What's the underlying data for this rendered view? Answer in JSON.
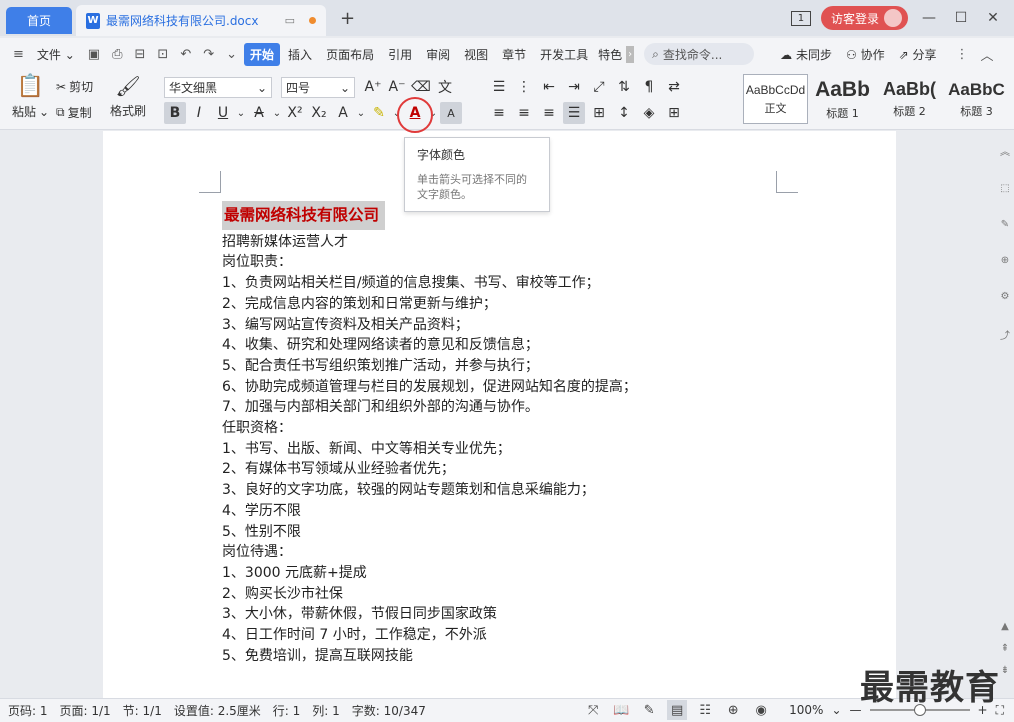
{
  "titlebar": {
    "home_tab": "首页",
    "doc_tab": "最需网络科技有限公司.docx",
    "doc_icon": "W",
    "window_count": "1",
    "login_label": "访客登录",
    "add_tab": "+"
  },
  "menubar": {
    "file": "文件",
    "tabs": [
      "开始",
      "插入",
      "页面布局",
      "引用",
      "审阅",
      "视图",
      "章节",
      "开发工具",
      "特色"
    ],
    "search": "查找命令...",
    "sync": "未同步",
    "collab": "协作",
    "share": "分享"
  },
  "ribbon": {
    "paste": "粘贴",
    "cut": "剪切",
    "copy": "复制",
    "format_painter": "格式刷",
    "font_name": "华文细黑",
    "font_size": "四号",
    "styles": [
      {
        "preview": "AaBbCcDd",
        "label": "正文"
      },
      {
        "preview": "AaBb",
        "label": "标题 1"
      },
      {
        "preview": "AaBb(",
        "label": "标题 2"
      },
      {
        "preview": "AaBbC",
        "label": "标题 3"
      }
    ]
  },
  "tooltip": {
    "title": "字体颜色",
    "body": "单击箭头可选择不同的文字颜色。"
  },
  "document": {
    "heading": "最需网络科技有限公司",
    "lines": [
      "招聘新媒体运营人才",
      "岗位职责：",
      "1、负责网站相关栏目/频道的信息搜集、书写、审校等工作；",
      "2、完成信息内容的策划和日常更新与维护；",
      "3、编写网站宣传资料及相关产品资料；",
      "4、收集、研究和处理网络读者的意见和反馈信息；",
      "5、配合责任书写组织策划推广活动，并参与执行；",
      "6、协助完成频道管理与栏目的发展规划，促进网站知名度的提高；",
      "7、加强与内部相关部门和组织外部的沟通与协作。",
      "任职资格：",
      "1、书写、出版、新闻、中文等相关专业优先；",
      "2、有媒体书写领域从业经验者优先；",
      "3、良好的文字功底，较强的网站专题策划和信息采编能力；",
      "4、学历不限",
      "5、性别不限",
      "岗位待遇：",
      "1、3000 元底薪+提成",
      "2、购买长沙市社保",
      "3、大小休，带薪休假，节假日同步国家政策",
      "4、日工作时间 7 小时，工作稳定，不外派",
      "5、免费培训，提高互联网技能"
    ]
  },
  "status": {
    "page_num": "页码: 1",
    "pages": "页面: 1/1",
    "section": "节: 1/1",
    "setting": "设置值: 2.5厘米",
    "row": "行: 1",
    "col": "列: 1",
    "word_count": "字数: 10/347",
    "zoom": "100%"
  },
  "watermark": "最需教育",
  "colors": {
    "accent": "#3f7fe8",
    "heading_red": "#c00000",
    "highlight": "#e03a3a"
  }
}
